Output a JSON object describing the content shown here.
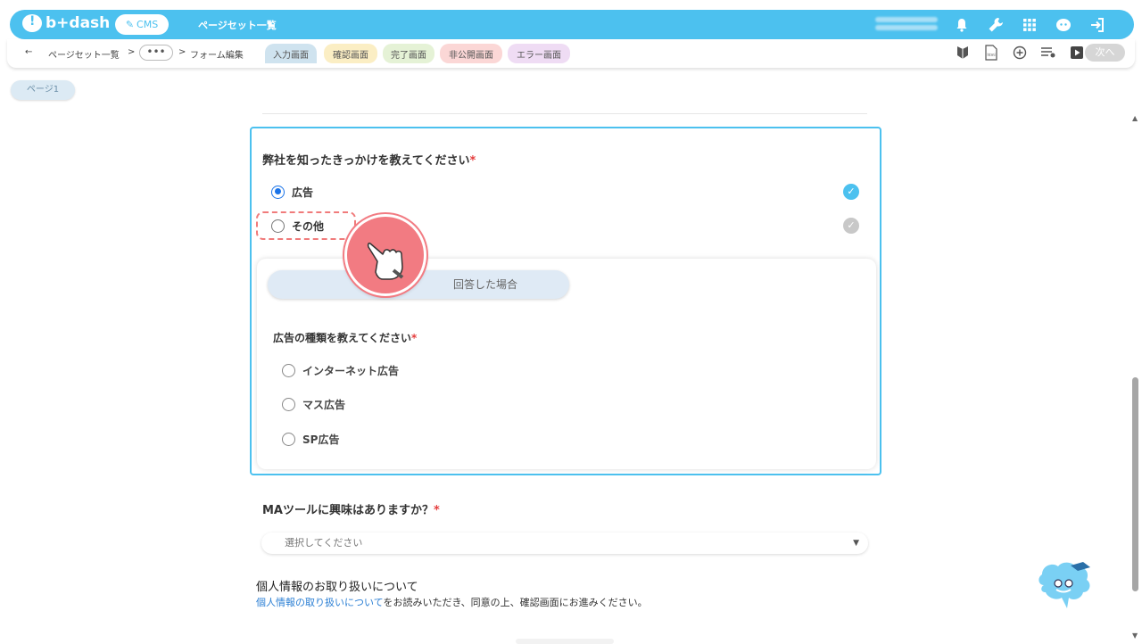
{
  "topbar": {
    "logo": "b+dash",
    "cms_label": "CMS",
    "title": "ページセット一覧"
  },
  "subbar": {
    "back_arrow": "←",
    "crumb1": "ページセット一覧",
    "sep1": ">",
    "dots": "•••",
    "sep2": ">",
    "crumb2": "フォーム編集",
    "tabs": [
      {
        "label": "入力画面",
        "color": "#cfe3ef"
      },
      {
        "label": "確認画面",
        "color": "#fbeec4"
      },
      {
        "label": "完了画面",
        "color": "#e5f2d6"
      },
      {
        "label": "非公開画面",
        "color": "#fbd7d6"
      },
      {
        "label": "エラー画面",
        "color": "#efdcf4"
      }
    ],
    "next_label": "次へ"
  },
  "page_chip": "ページ1",
  "question": {
    "label": "弊社を知ったきっかけを教えてください",
    "required_mark": "*",
    "options": [
      {
        "label": "広告",
        "selected": true
      },
      {
        "label": "その他",
        "selected": false
      }
    ]
  },
  "conditional": {
    "pill_text": "回答した場合",
    "sub_label": "広告の種類を教えてください",
    "required_mark": "*",
    "options": [
      "インターネット広告",
      "マス広告",
      "SP広告"
    ]
  },
  "ma_question": {
    "label": "MAツールに興味はありますか？",
    "required_mark": "*",
    "select_placeholder": "選択してください"
  },
  "privacy": {
    "title": "個人情報のお取り扱いについて",
    "link_text": "個人情報の取り扱いについて",
    "rest_text": "をお読みいただき、同意の上、確認画面にお進みください。"
  },
  "colors": {
    "accent": "#4cc1ef",
    "highlight": "#f07b7b",
    "required": "#e53e3e",
    "link": "#2b7fd4"
  },
  "icons": {
    "top": [
      "bell-icon",
      "wrench-icon",
      "grid-icon",
      "support-icon",
      "logout-icon"
    ],
    "subbar": [
      "beginner-icon",
      "html-file-icon",
      "add-circle-icon",
      "list-settings-icon",
      "play-icon"
    ]
  }
}
